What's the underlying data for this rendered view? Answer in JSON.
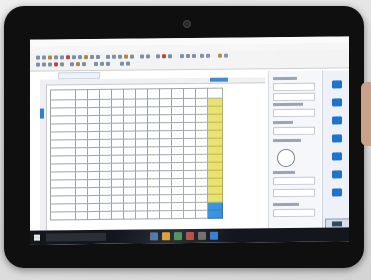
{
  "scene": {
    "device": "tablet",
    "bezel_color": "#0f0f10",
    "app_accent": "#1f73c8",
    "highlight_column_color": "#e7e066",
    "selected_cell_color": "#2f8fe0"
  },
  "app": {
    "menus": [
      "",
      "",
      "",
      "",
      "",
      "",
      "",
      "",
      ""
    ]
  },
  "grid": {
    "columns": 14,
    "rows": 13,
    "highlighted_column_index": 12
  },
  "right_toolbar": {
    "icons": [
      "comment-icon",
      "image-icon",
      "table-icon",
      "camera-icon",
      "layout-icon",
      "zoom-icon",
      "export-icon"
    ]
  },
  "taskbar": {
    "start_icon": "windows-start-icon",
    "search_icon": "search-icon"
  }
}
